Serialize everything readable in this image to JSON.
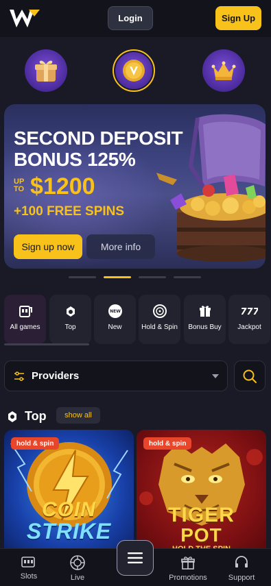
{
  "header": {
    "login_label": "Login",
    "signup_label": "Sign Up",
    "brand_color": "#f9c21b"
  },
  "promo_icons": [
    "gift-icon",
    "bonus-coin-icon",
    "crown-icon"
  ],
  "banner": {
    "title": "SECOND DEPOSIT BONUS 125%",
    "upto": "UP TO",
    "amount": "$1200",
    "spins": "+100 FREE SPINS",
    "signup_now_label": "Sign up now",
    "more_info_label": "More info"
  },
  "carousel": {
    "total": 4,
    "active": 2
  },
  "categories": [
    {
      "label": "All games",
      "icon": "slot-machine-icon"
    },
    {
      "label": "Top",
      "icon": "top-icon"
    },
    {
      "label": "New",
      "icon": "new-icon"
    },
    {
      "label": "Hold & Spin",
      "icon": "roulette-icon"
    },
    {
      "label": "Bonus Buy",
      "icon": "gift-icon"
    },
    {
      "label": "Jackpot",
      "icon": "jackpot-777-icon"
    }
  ],
  "providers": {
    "label": "Providers"
  },
  "top_section": {
    "title": "Top",
    "show_all_label": "show all"
  },
  "games": [
    {
      "title_line1": "COIN",
      "title_line2": "STRIKE",
      "badge": "hold & spin"
    },
    {
      "title_line1": "TIGER",
      "title_line2": "POT",
      "subtitle": "HOLD THE SPIN",
      "badge": "hold & spin"
    }
  ],
  "bottom_nav": {
    "slots": "Slots",
    "live": "Live",
    "promotions": "Promotions",
    "support": "Support"
  }
}
